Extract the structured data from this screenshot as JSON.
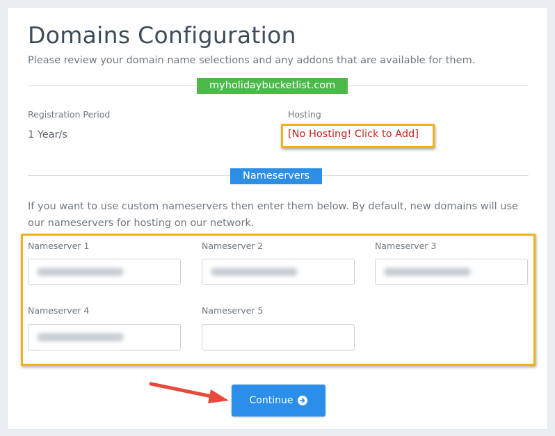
{
  "page": {
    "title": "Domains Configuration",
    "subtitle": "Please review your domain name selections and any addons that are available for them."
  },
  "domain": {
    "name": "myholidaybucketlist.com"
  },
  "registration": {
    "label": "Registration Period",
    "value": "1 Year/s"
  },
  "hosting": {
    "label": "Hosting",
    "link_text": "[No Hosting! Click to Add]"
  },
  "nameservers": {
    "heading": "Nameservers",
    "description": "If you want to use custom nameservers then enter them below. By default, new domains will use our nameservers for hosting on our network.",
    "fields": [
      {
        "label": "Nameserver 1",
        "blurred": true
      },
      {
        "label": "Nameserver 2",
        "blurred": true
      },
      {
        "label": "Nameserver 3",
        "blurred": true
      },
      {
        "label": "Nameserver 4",
        "blurred": true
      },
      {
        "label": "Nameserver 5",
        "blurred": false
      }
    ]
  },
  "actions": {
    "continue_label": "Continue"
  },
  "colors": {
    "accent_blue": "#2b8ee8",
    "domain_green": "#4cb94a",
    "highlight_orange": "#f0b21a",
    "hosting_red": "#c7211f",
    "annotation_arrow": "#e8493a"
  },
  "icons": {
    "continue_icon": "arrow-circle-right-icon",
    "annotation": "red-arrow-icon"
  }
}
